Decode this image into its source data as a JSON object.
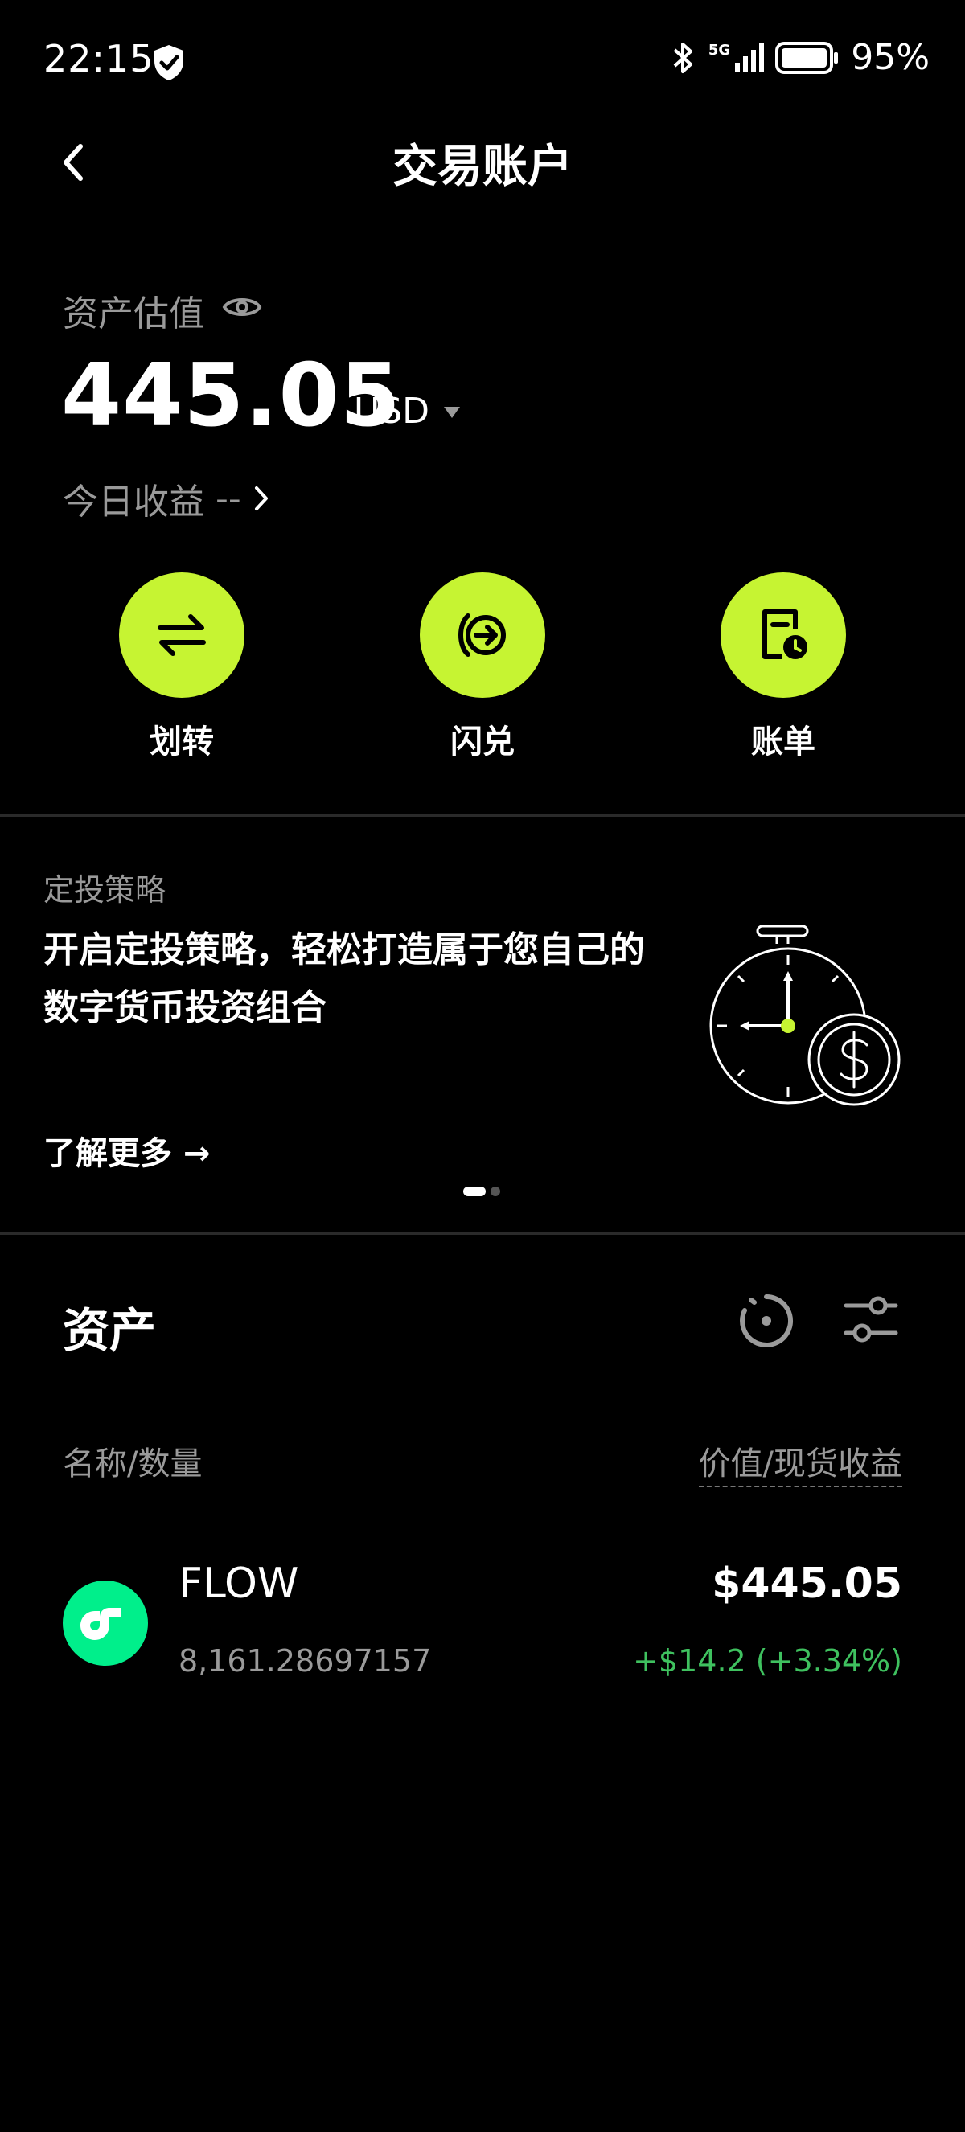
{
  "status_bar": {
    "time": "22:15",
    "network": "5G",
    "battery": "95%"
  },
  "header": {
    "title": "交易账户"
  },
  "balance": {
    "label": "资产估值",
    "value": "445.05",
    "currency": "USD",
    "today_label": "今日收益",
    "today_value": "--"
  },
  "actions": [
    {
      "label": "划转",
      "icon": "transfer-icon"
    },
    {
      "label": "闪兑",
      "icon": "flash-swap-icon"
    },
    {
      "label": "账单",
      "icon": "bill-icon"
    }
  ],
  "banner": {
    "kicker": "定投策略",
    "title": "开启定投策略，轻松打造属于您自己的数字货币投资组合",
    "cta": "了解更多 →",
    "active_page": 1,
    "total_pages": 2
  },
  "assets": {
    "heading": "资产",
    "col_left": "名称/数量",
    "col_right": "价值/现货收益",
    "rows": [
      {
        "name": "FLOW",
        "quantity": "8,161.28697157",
        "value": "$445.05",
        "pnl": "+$14.2 (+3.34%)"
      }
    ]
  },
  "colors": {
    "accent": "#c6f432",
    "positive": "#3fc15f",
    "flow_brand": "#00ef8b",
    "background": "#000000"
  }
}
